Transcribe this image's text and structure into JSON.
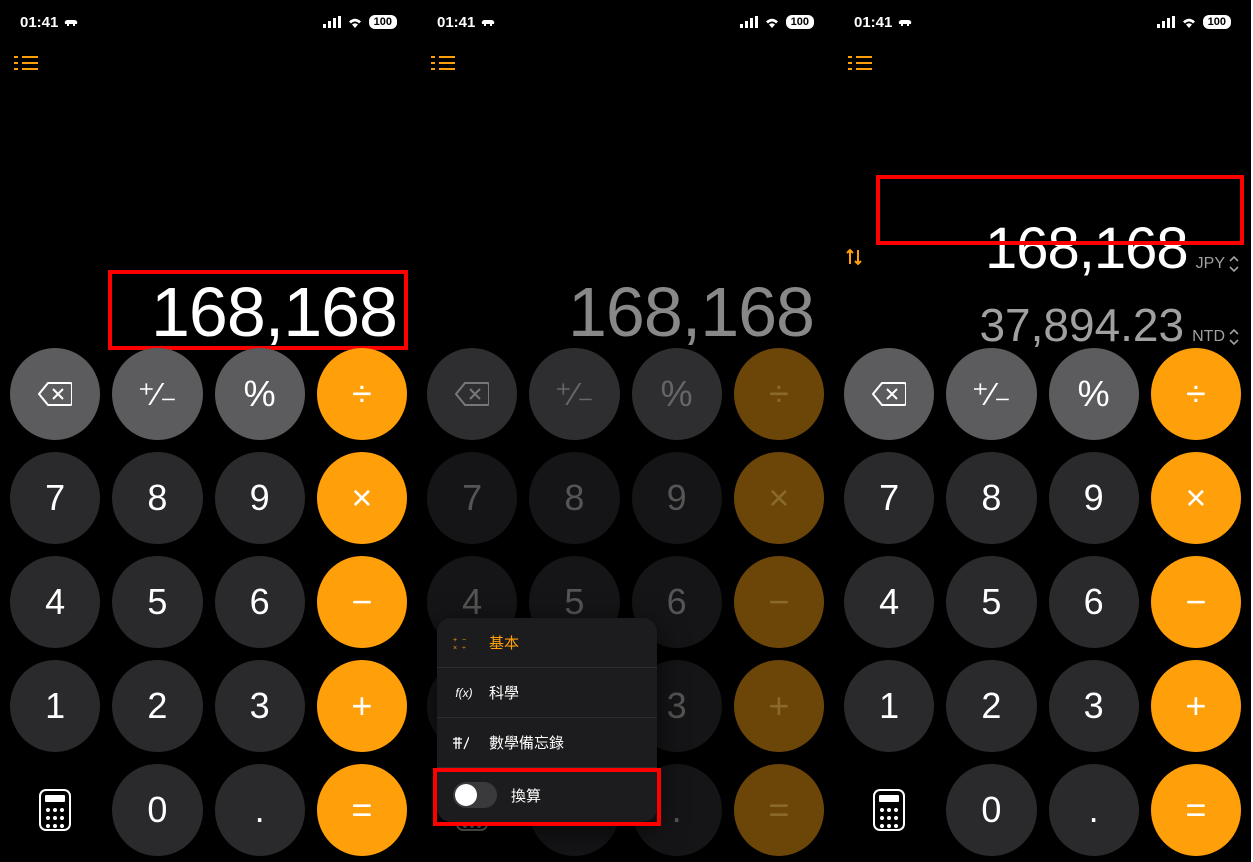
{
  "statusbar": {
    "time": "01:41",
    "battery": "100"
  },
  "screen1": {
    "display": "168,168"
  },
  "screen2": {
    "display": "168,168",
    "popup": {
      "basic": "基本",
      "scientific": "科學",
      "mathnotes": "數學備忘錄",
      "convert": "換算"
    }
  },
  "screen3": {
    "input_value": "168,168",
    "input_currency": "JPY",
    "output_value": "37,894.23",
    "output_currency": "NTD"
  },
  "keys": {
    "plusminus": "⁺∕₋",
    "percent": "%",
    "divide": "÷",
    "multiply": "×",
    "minus": "−",
    "plus": "+",
    "equals": "=",
    "dot": ".",
    "d7": "7",
    "d8": "8",
    "d9": "9",
    "d4": "4",
    "d5": "5",
    "d6": "6",
    "d1": "1",
    "d2": "2",
    "d3": "3",
    "d0": "0"
  }
}
